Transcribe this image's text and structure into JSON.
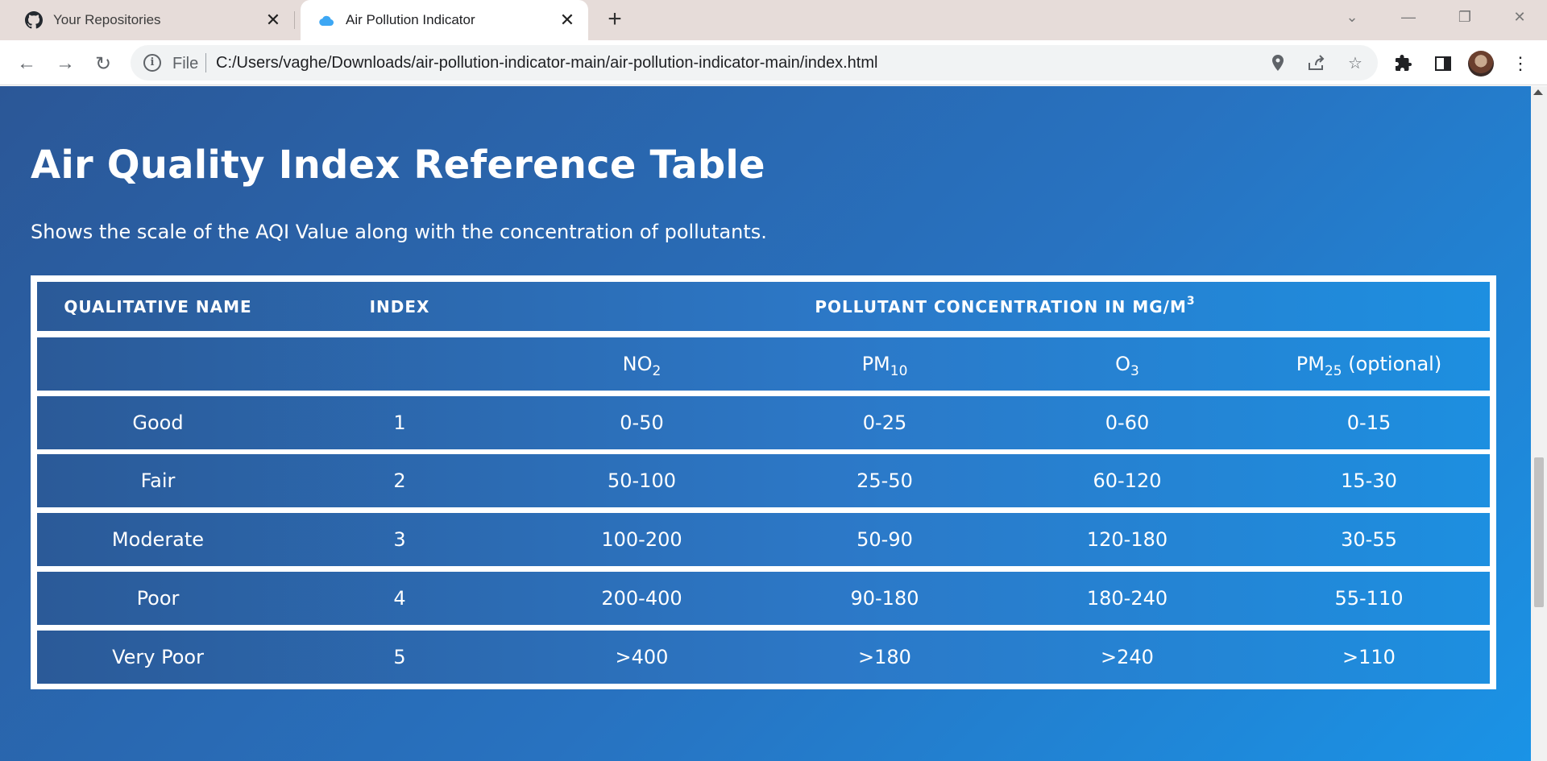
{
  "browser": {
    "tabs": [
      {
        "title": "Your Repositories",
        "icon": "github-icon"
      },
      {
        "title": "Air Pollution Indicator",
        "icon": "cloud-icon"
      }
    ],
    "address_scheme": "File",
    "url": "C:/Users/vaghe/Downloads/air-pollution-indicator-main/air-pollution-indicator-main/index.html"
  },
  "page": {
    "title": "Air Quality Index Reference Table",
    "subtitle": "Shows the scale of the AQI Value along with the concentration of pollutants.",
    "table": {
      "header": {
        "qualitative_name": "QUALITATIVE NAME",
        "index": "INDEX",
        "pollutant_concentration": "POLLUTANT CONCENTRATION IN ΜG/M",
        "pollutant_concentration_sup": "3"
      },
      "pollutants": [
        {
          "base": "NO",
          "sub": "2",
          "suffix": ""
        },
        {
          "base": "PM",
          "sub": "10",
          "suffix": ""
        },
        {
          "base": "O",
          "sub": "3",
          "suffix": ""
        },
        {
          "base": "PM",
          "sub": "25",
          "suffix": " (optional)"
        }
      ],
      "rows": [
        {
          "name": "Good",
          "index": "1",
          "no2": "0-50",
          "pm10": "0-25",
          "o3": "0-60",
          "pm25": "0-15"
        },
        {
          "name": "Fair",
          "index": "2",
          "no2": "50-100",
          "pm10": "25-50",
          "o3": "60-120",
          "pm25": "15-30"
        },
        {
          "name": "Moderate",
          "index": "3",
          "no2": "100-200",
          "pm10": "50-90",
          "o3": "120-180",
          "pm25": "30-55"
        },
        {
          "name": "Poor",
          "index": "4",
          "no2": "200-400",
          "pm10": "90-180",
          "o3": "180-240",
          "pm25": "55-110"
        },
        {
          "name": "Very Poor",
          "index": "5",
          "no2": ">400",
          "pm10": ">180",
          "o3": ">240",
          "pm25": ">110"
        }
      ]
    }
  },
  "colors": {
    "background_start": "#2b5797",
    "background_end": "#1a93e6",
    "table_border": "#ffffff",
    "text": "#ffffff"
  }
}
